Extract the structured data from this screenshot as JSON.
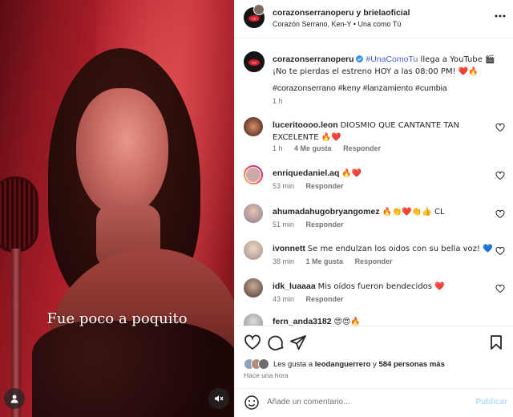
{
  "media": {
    "caption": "Fue poco a poquito"
  },
  "header": {
    "account": "corazonserranoperu",
    "joiner": "y",
    "collaborator": "brielaoficial",
    "song": "Corazón Serrano, Ken-Y • Una como Tú"
  },
  "post": {
    "username": "corazonserranoperu",
    "hashtag_main": "#UnaComoTu",
    "text": " llega a YouTube 🎬 ¡No te pierdas el estreno HOY a las 08:00 PM! ❤️🔥",
    "hashtags": "#corazonserrano #keny #lanzamiento #cumbia",
    "time": "1 h"
  },
  "comments": [
    {
      "user": "luceritoooo.leon",
      "text": "DIOSMIO QUE CANTANTE TAN EXCELENTE 🔥❤️",
      "time": "1 h",
      "likes": "4 Me gusta",
      "reply": "Responder"
    },
    {
      "user": "enriquedaniel.aq",
      "text": "🔥❤️",
      "time": "53 min",
      "reply": "Responder"
    },
    {
      "user": "ahumadahugobryangomez",
      "text": "🔥👏❤️👏👍 CL",
      "time": "51 min",
      "reply": "Responder"
    },
    {
      "user": "ivonnett",
      "text": "Se me endulzan los oidos con su bella voz! 💙",
      "time": "38 min",
      "likes": "1 Me gusta",
      "reply": "Responder"
    },
    {
      "user": "idk_luaaaa",
      "text": "Mis oídos fueron bendecidos ❤️",
      "time": "43 min",
      "reply": "Responder"
    },
    {
      "user": "fern_anda3182",
      "text": "😍😍🔥"
    }
  ],
  "likes": {
    "prefix": "Les gusta a",
    "user": "leodanguerrero",
    "joiner": "y",
    "count": "584 personas más"
  },
  "posted": "Hace una hora",
  "composer": {
    "placeholder": "Añade un comentario...",
    "post_label": "Publicar"
  },
  "colors": {
    "hashtag": "#4a5fd1",
    "like_red": "#ed4956",
    "verified": "#3897f0"
  }
}
